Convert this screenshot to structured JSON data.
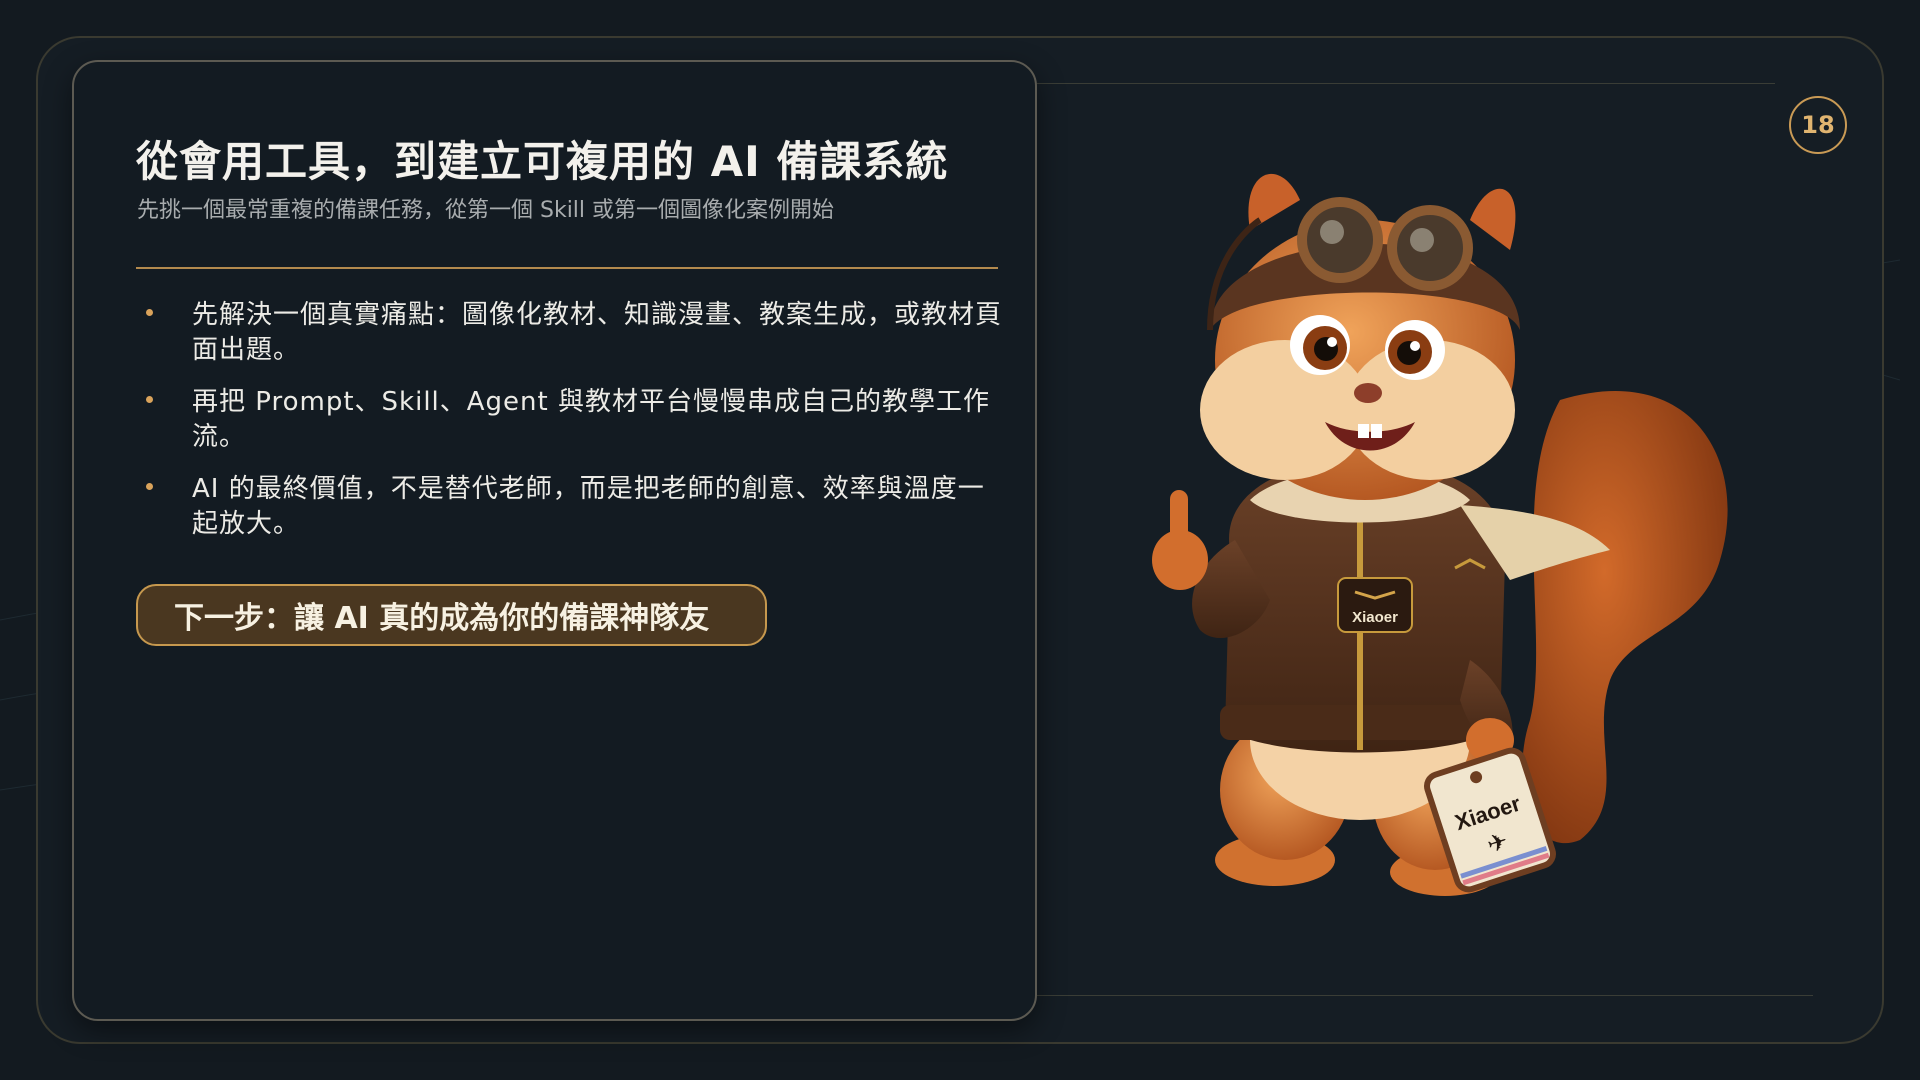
{
  "slide": {
    "number": "18",
    "title": "從會用工具，到建立可複用的 AI 備課系統",
    "subtitle": "先挑一個最常重複的備課任務，從第一個 Skill 或第一個圖像化案例開始",
    "bullets": [
      "先解決一個真實痛點：圖像化教材、知識漫畫、教案生成，或教材頁面出題。",
      "再把 Prompt、Skill、Agent 與教材平台慢慢串成自己的教學工作流。",
      "AI 的最終價值，不是替代老師，而是把老師的創意、效率與溫度一起放大。"
    ],
    "next_step": "下一步：讓 AI 真的成為你的備課神隊友"
  },
  "mascot": {
    "jacket_badge": "Xiaoer",
    "luggage_tag": "Xiaoer"
  },
  "colors": {
    "background": "#131a20",
    "accent_gold": "#c99a55",
    "button_fill": "#4a3720",
    "text_primary": "#f3f1ec",
    "text_muted": "#a8acae"
  },
  "icons": [
    "pilot-squirrel-mascot",
    "airplane-icon",
    "wings-icon"
  ]
}
